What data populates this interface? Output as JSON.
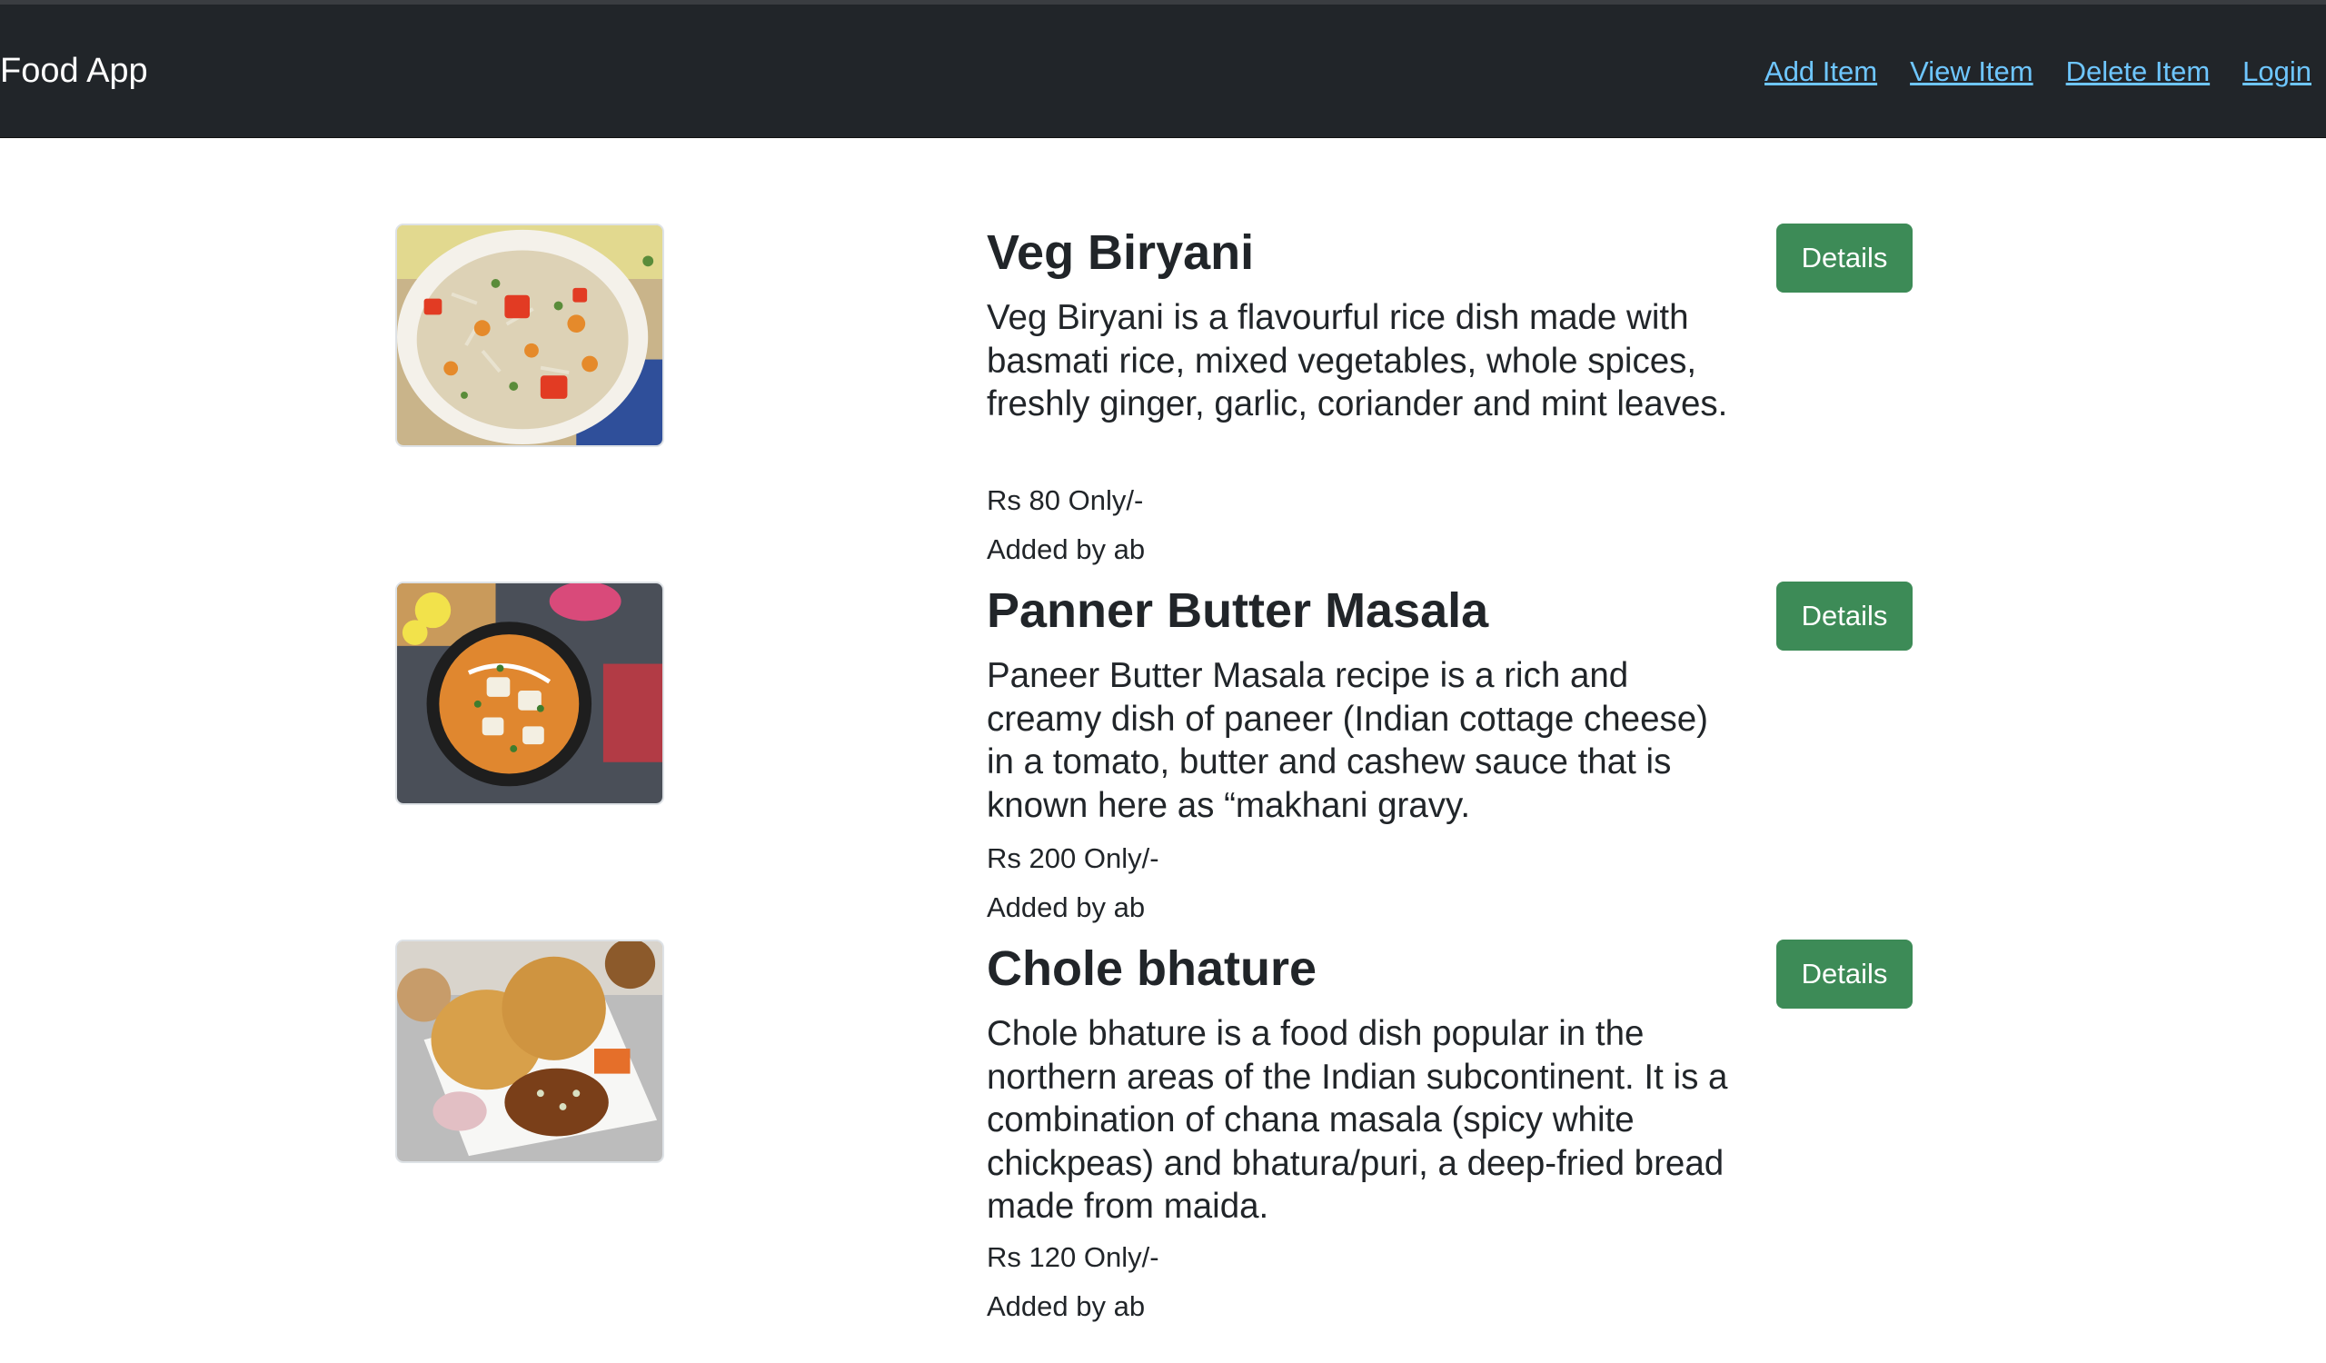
{
  "navbar": {
    "brand": "Food App",
    "links": [
      "Add Item",
      "View Item",
      "Delete Item",
      "Login"
    ]
  },
  "items": [
    {
      "title": "Veg Biryani",
      "description": "Veg Biryani is a flavourful rice dish made with basmati rice, mixed vegetables, whole spices, freshly ginger, garlic, coriander and mint leaves.",
      "price": "Rs 80 Only/-",
      "added_by": "Added by ab",
      "button": "Details"
    },
    {
      "title": "Panner Butter Masala",
      "description": "Paneer Butter Masala recipe is a rich and creamy dish of paneer (Indian cottage cheese) in a tomato, butter and cashew sauce that is known here as “makhani gravy.",
      "price": "Rs 200 Only/-",
      "added_by": "Added by ab",
      "button": "Details"
    },
    {
      "title": "Chole bhature",
      "description": "Chole bhature is a food dish popular in the northern areas of the Indian subcontinent. It is a combination of chana masala (spicy white chickpeas) and bhatura/puri, a deep-fried bread made from maida.",
      "price": "Rs 120 Only/-",
      "added_by": "Added by ab",
      "button": "Details"
    }
  ],
  "colors": {
    "navbar_bg": "#212529",
    "link": "#6ec6ff",
    "button_bg": "#3d8b57"
  }
}
